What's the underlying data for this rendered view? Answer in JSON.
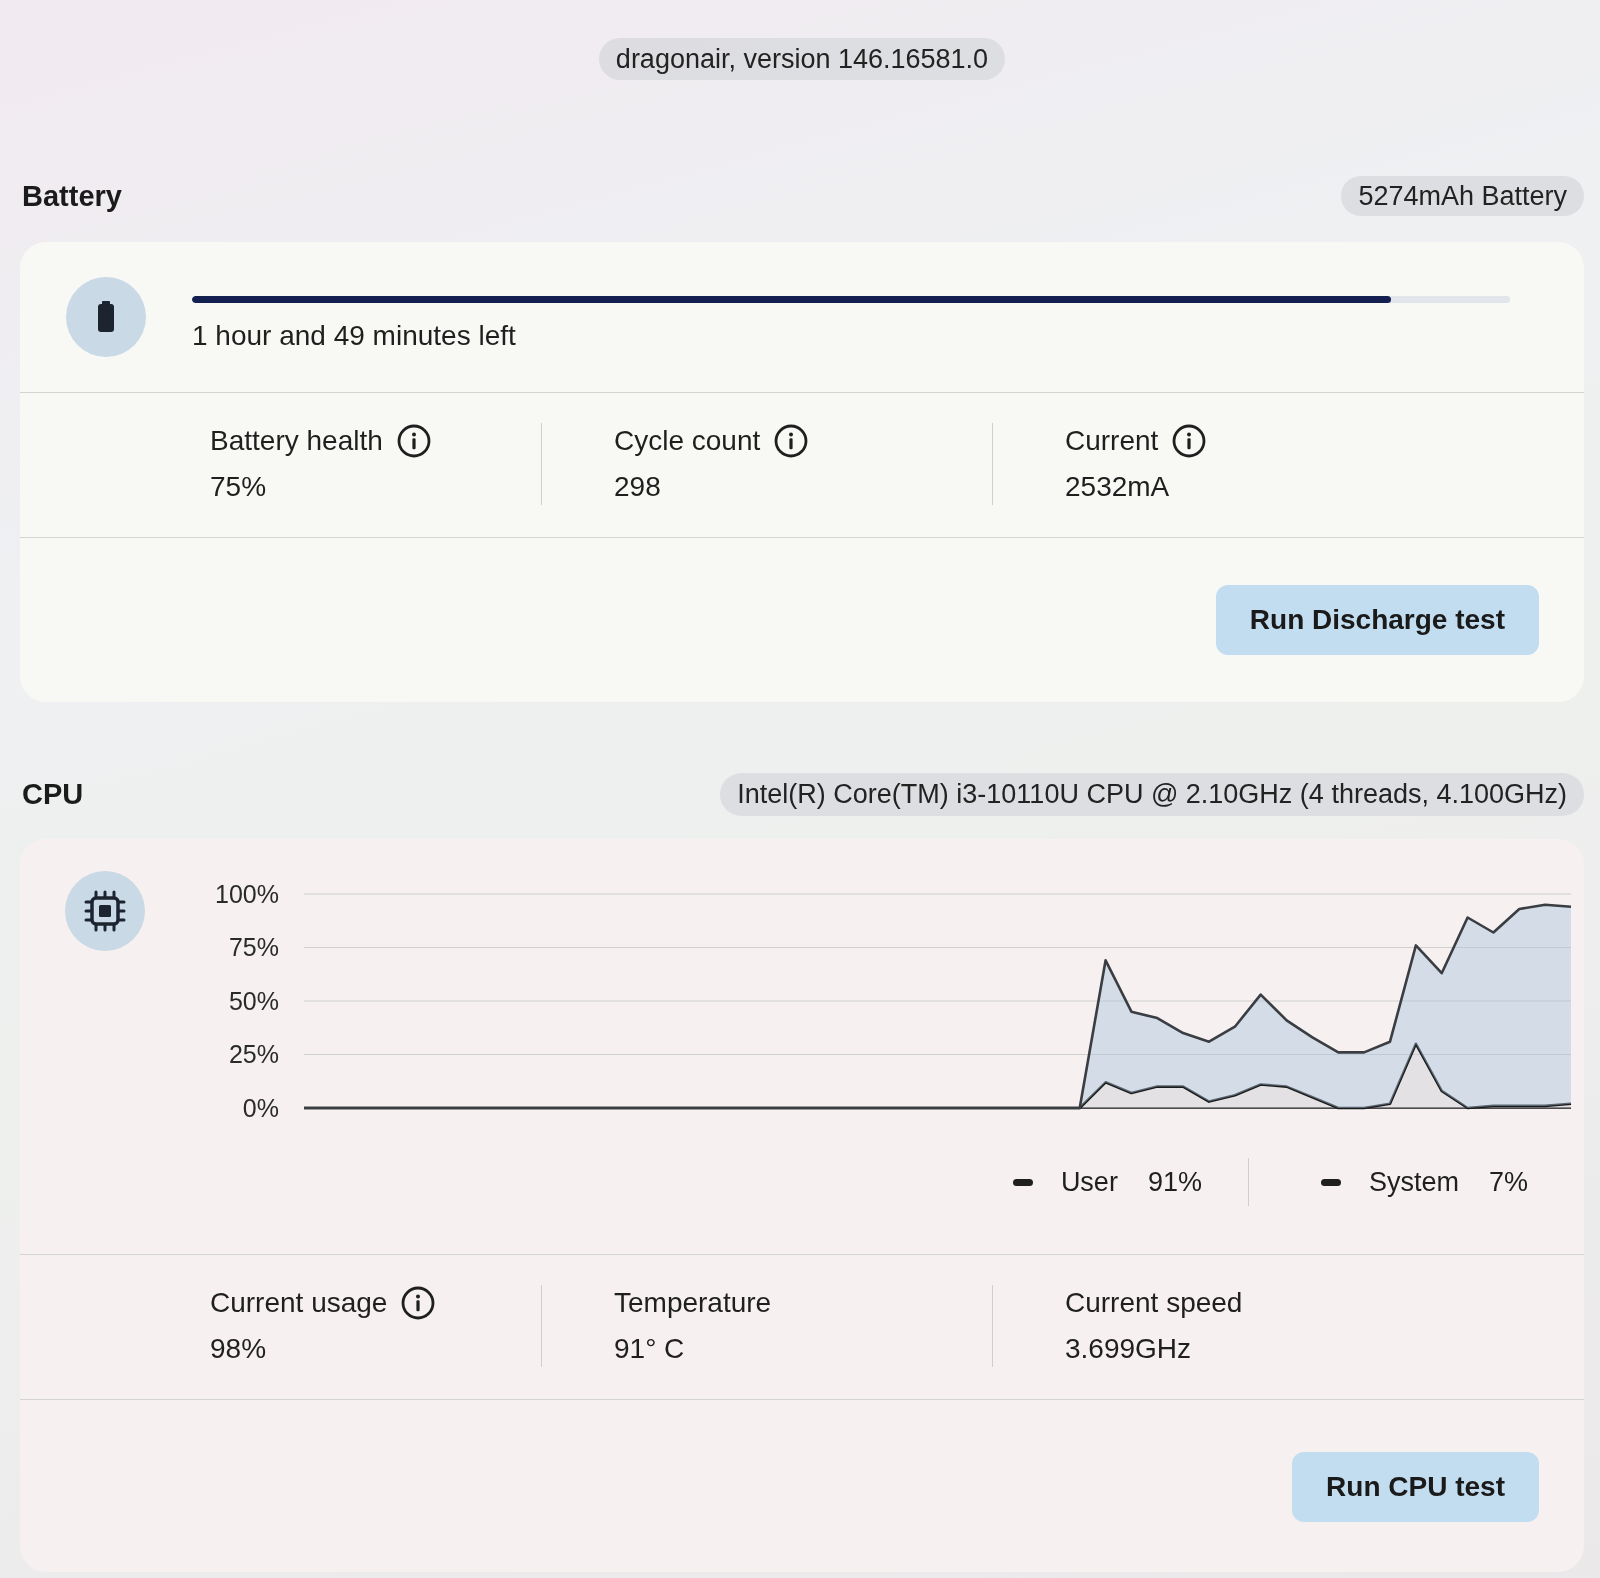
{
  "header": {
    "version": "dragonair, version 146.16581.0"
  },
  "battery": {
    "title": "Battery",
    "badge": "5274mAh Battery",
    "charge": {
      "level": 0.91,
      "time_left": "1 hour and 49 minutes left"
    },
    "stats": [
      {
        "label": "Battery health",
        "info": true,
        "value": "75%"
      },
      {
        "label": "Cycle count",
        "info": true,
        "value": "298"
      },
      {
        "label": "Current",
        "info": true,
        "value": "2532mA"
      }
    ],
    "button": "Run Discharge test"
  },
  "cpu": {
    "title": "CPU",
    "badge": "Intel(R) Core(TM) i3-10110U CPU @ 2.10GHz (4 threads, 4.100GHz)",
    "chart_data": {
      "type": "area",
      "stacked": true,
      "grid": true,
      "ylim": [
        0,
        100
      ],
      "yticks": [
        {
          "value": 100,
          "label": "100%"
        },
        {
          "value": 75,
          "label": "75%"
        },
        {
          "value": 50,
          "label": "50%"
        },
        {
          "value": 25,
          "label": "25%"
        },
        {
          "value": 0,
          "label": "0%"
        }
      ],
      "series": [
        {
          "name": "System",
          "color": "#1a1a1a",
          "values": [
            0,
            0,
            0,
            0,
            0,
            0,
            0,
            0,
            0,
            0,
            0,
            0,
            0,
            0,
            0,
            0,
            0,
            0,
            0,
            0,
            0,
            0,
            0,
            0,
            0,
            0,
            0,
            0,
            0,
            0,
            0,
            12,
            7,
            10,
            10,
            3,
            6,
            11,
            10,
            5,
            0,
            0,
            2,
            30,
            8,
            0,
            1,
            1,
            1,
            2
          ]
        },
        {
          "name": "User",
          "color": "#3a3d42",
          "values": [
            0,
            0,
            0,
            0,
            0,
            0,
            0,
            0,
            0,
            0,
            0,
            0,
            0,
            0,
            0,
            0,
            0,
            0,
            0,
            0,
            0,
            0,
            0,
            0,
            0,
            0,
            0,
            0,
            0,
            0,
            0,
            57,
            38,
            32,
            25,
            28,
            32,
            42,
            31,
            28,
            26,
            26,
            29,
            46,
            55,
            89,
            81,
            92,
            94,
            92
          ]
        }
      ]
    },
    "legend_values": [
      "91%",
      "7%"
    ],
    "stats": [
      {
        "label": "Current usage",
        "info": true,
        "value": "98%"
      },
      {
        "label": "Temperature",
        "info": false,
        "value": "91° C"
      },
      {
        "label": "Current speed",
        "info": false,
        "value": "3.699GHz"
      }
    ],
    "button": "Run CPU test"
  }
}
